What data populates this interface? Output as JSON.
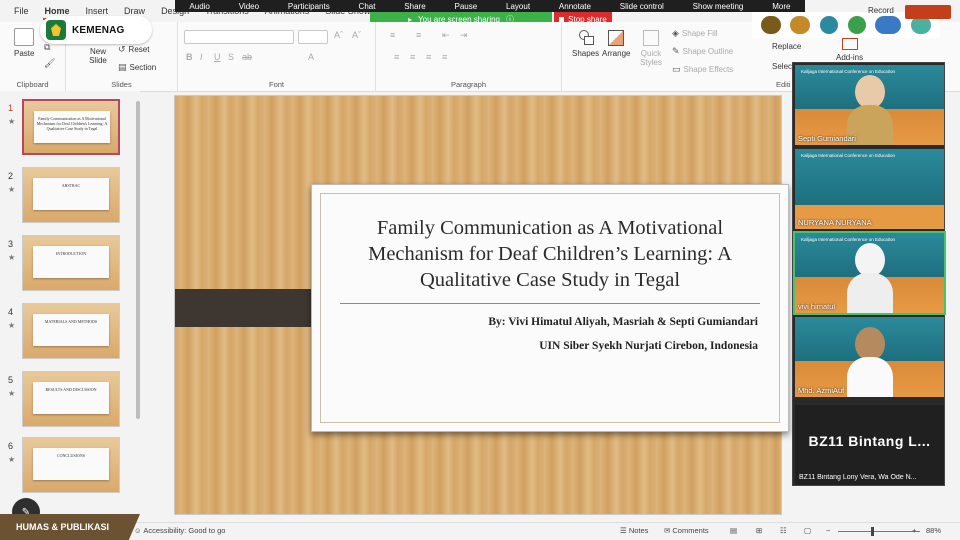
{
  "menu": {
    "tabs": [
      "File",
      "Home",
      "Insert",
      "Draw",
      "Design",
      "Transitions",
      "Animations",
      "Slide Show"
    ],
    "active_tab": "Home"
  },
  "meeting": {
    "controls": [
      "Audio",
      "Video",
      "Participants",
      "Chat",
      "Share",
      "Pause",
      "Layout",
      "Annotate",
      "Slide control",
      "Show meeting",
      "More"
    ],
    "sharing_banner": "You are screen sharing",
    "stop_share": "Stop share"
  },
  "logo_badge": {
    "text": "KEMENAG"
  },
  "ribbon": {
    "clipboard": {
      "paste": "Paste",
      "label": "Clipboard"
    },
    "slides": {
      "new_slide": "New Slide",
      "reset": "Reset",
      "section": "Section",
      "label": "Slides"
    },
    "font": {
      "label": "Font"
    },
    "paragraph": {
      "label": "Paragraph"
    },
    "drawing": {
      "shapes": "Shapes",
      "arrange": "Arrange",
      "quick_styles": "Quick Styles",
      "shape_fill": "Shape Fill",
      "shape_outline": "Shape Outline",
      "shape_effects": "Shape Effects"
    },
    "editing": {
      "replace": "Replace",
      "select": "Select",
      "label": "Editi"
    },
    "addins": {
      "label": "Add-ins"
    }
  },
  "top_right": {
    "record": "Record"
  },
  "thumbnails": [
    {
      "num": "1",
      "title": "Family Communication as A Motivational Mechanism for Deaf Children's Learning: A Qualitative Case Study in Tegal",
      "selected": true
    },
    {
      "num": "2",
      "title": "ABSTRAC",
      "selected": false
    },
    {
      "num": "3",
      "title": "INTRODUCTION",
      "selected": false
    },
    {
      "num": "4",
      "title": "MATERIALS AND METHODS",
      "selected": false
    },
    {
      "num": "5",
      "title": "RESULTS AND DISCUSSION",
      "selected": false
    },
    {
      "num": "6",
      "title": "CONCLUSIONS",
      "selected": false
    }
  ],
  "slide": {
    "title": "Family Communication as A Motivational Mechanism for Deaf Children’s Learning: A Qualitative Case Study in Tegal",
    "authors": "By: Vivi Himatul Aliyah, Masriah & Septi Gumiandari",
    "institution": "UIN Siber Syekh Nurjati Cirebon, Indonesia"
  },
  "participants": [
    {
      "name": "Septi Gumiandari",
      "active": false
    },
    {
      "name": "NURYANA NURYANA",
      "active": false
    },
    {
      "name": "vivi himatul",
      "active": true
    },
    {
      "name": "Mhd. AzmiAuf",
      "active": false
    }
  ],
  "participant_banner": "Kalijaga International Conference on Education",
  "big_tile": {
    "name": "BZ11 Bintang L...",
    "caption": "BZ11 Bintang Lony Vera, Wa Ode N..."
  },
  "status": {
    "accessibility": "Accessibility: Good to go",
    "notes": "Notes",
    "comments": "Comments",
    "zoom": "88%"
  },
  "footer_badge": "HUMAS & PUBLIKASI",
  "colors": {
    "accent": "#c43e1c",
    "share_green": "#3cb14a",
    "stop_red": "#d92c2c",
    "thumb_selected": "#b5485e"
  }
}
